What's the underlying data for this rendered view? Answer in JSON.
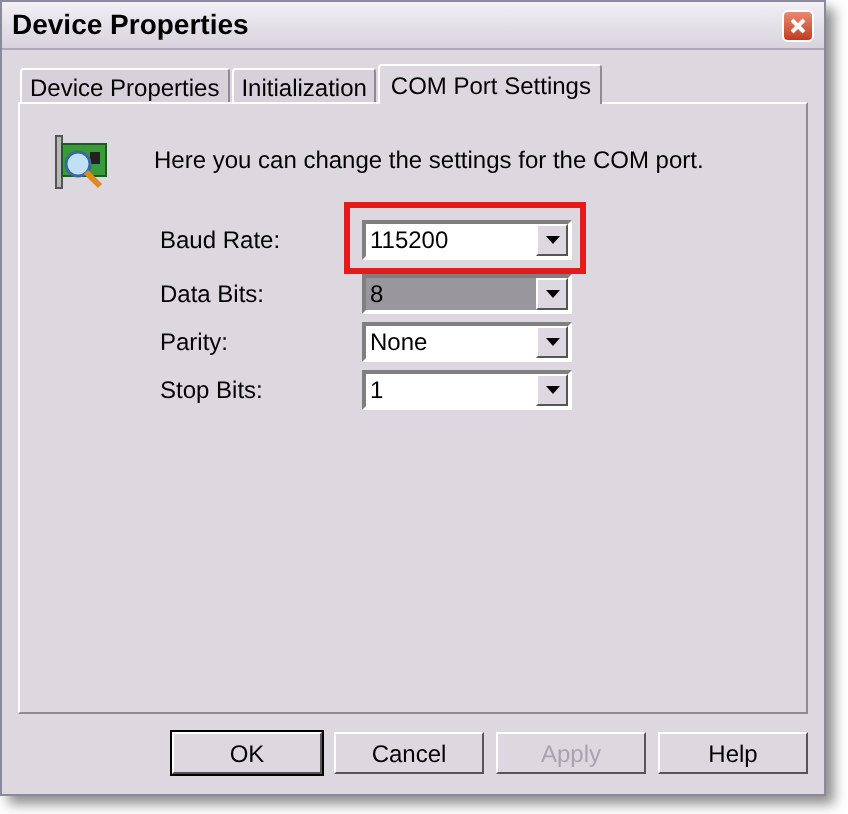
{
  "window": {
    "title": "Device Properties"
  },
  "tabs": [
    {
      "label": "Device Properties",
      "selected": false
    },
    {
      "label": "Initialization",
      "selected": false
    },
    {
      "label": "COM Port Settings",
      "selected": true
    }
  ],
  "intro": "Here you can change the settings for the COM port.",
  "fields": [
    {
      "label": "Baud Rate:",
      "value": "115200",
      "highlighted": false,
      "annotated": true
    },
    {
      "label": "Data Bits:",
      "value": "8",
      "highlighted": true,
      "annotated": false
    },
    {
      "label": "Parity:",
      "value": "None",
      "highlighted": false,
      "annotated": false
    },
    {
      "label": "Stop Bits:",
      "value": "1",
      "highlighted": false,
      "annotated": false
    }
  ],
  "buttons": [
    {
      "label": "OK",
      "default": true,
      "disabled": false
    },
    {
      "label": "Cancel",
      "default": false,
      "disabled": false
    },
    {
      "label": "Apply",
      "default": false,
      "disabled": true
    },
    {
      "label": "Help",
      "default": false,
      "disabled": false
    }
  ]
}
